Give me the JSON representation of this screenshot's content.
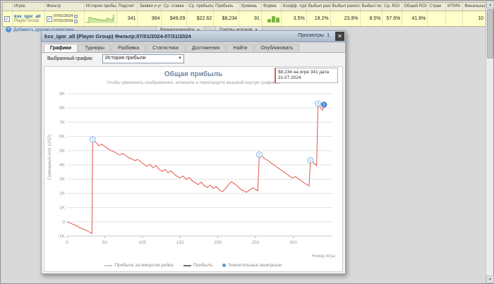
{
  "table": {
    "columns": [
      "",
      "Игрок",
      "Фильтр",
      "История прибыли",
      "Подсчет",
      "Заявки и уч.",
      "Ср. ставка",
      "Ср. прибыль",
      "Прибыль",
      "Уровень",
      "Форма",
      "Коэфф. турб.",
      "Выбыл рано",
      "Выбыл рано/средне",
      "Выбыл по.",
      "Ср. ROI",
      "Общий ROI",
      "Стран",
      "ИТМ%",
      "Финальные"
    ],
    "row": {
      "player_name": "ksv_igor_all",
      "player_type": "Player Group",
      "filter_date_from": "07/01/2024",
      "filter_date_to": "07/31/2024",
      "count": "341",
      "entries": "364",
      "avg_stake": "$49.09",
      "avg_profit": "$22.62",
      "profit": "$8,234",
      "ability": "91",
      "turbo_factor": "3.5%",
      "busted_early": "19.2%",
      "busted_early_mid": "23.9%",
      "busted_late": "8.5%",
      "avg_roi": "57.6%",
      "total_roi": "41.9%",
      "country": "",
      "itm": "",
      "final_tables": "10"
    }
  },
  "toolbar": {
    "add_stat_label": "Добавить другую статистику",
    "visualize_label": "Визуализируйте",
    "groups_label": "Группы игроков"
  },
  "window": {
    "title": "ksv_igor_all (Player Group) Фильтр:07/01/2024-07/31/2024",
    "views_label": "Просмотры",
    "views_count": "1",
    "tabs": [
      {
        "label": "Графики",
        "active": true
      },
      {
        "label": "Турниры",
        "active": false
      },
      {
        "label": "Разбивка",
        "active": false
      },
      {
        "label": "Статистика",
        "active": false
      },
      {
        "label": "Достижения",
        "active": false
      },
      {
        "label": "Найти",
        "active": false
      },
      {
        "label": "Опубликовать",
        "active": false
      }
    ],
    "selector_label": "Выбранный график:",
    "selector_value": "История прибыли"
  },
  "chart_data": {
    "type": "line",
    "title": "Общая прибыль",
    "subtitle": "Чтобы увеличить изображение, кликните и перетащите мышкой внутри графика.",
    "xlabel": "Номер игры",
    "ylabel": "Суммарный итог (USD)",
    "xlim": [
      0,
      352
    ],
    "ylim": [
      -1000,
      9000
    ],
    "xticks": [
      0,
      50,
      100,
      150,
      200,
      250,
      300
    ],
    "yticks": [
      {
        "v": 9000,
        "label": "9K"
      },
      {
        "v": 8000,
        "label": "8K"
      },
      {
        "v": 7000,
        "label": "7K"
      },
      {
        "v": 6000,
        "label": "6K"
      },
      {
        "v": 5000,
        "label": "5K"
      },
      {
        "v": 4000,
        "label": "4K"
      },
      {
        "v": 3000,
        "label": "3K"
      },
      {
        "v": 2000,
        "label": "2K"
      },
      {
        "v": 1000,
        "label": "1K"
      },
      {
        "v": 0,
        "label": "0"
      },
      {
        "v": -1000,
        "label": "-1K"
      }
    ],
    "line_color": "#e2574c",
    "marker_color": "#5b9bd5",
    "marker_highlight_color": "#3c78c8",
    "grid_color": "#e3e3e3",
    "points": [
      [
        0,
        0
      ],
      [
        4,
        -80
      ],
      [
        8,
        -180
      ],
      [
        12,
        -260
      ],
      [
        16,
        -380
      ],
      [
        20,
        -480
      ],
      [
        24,
        -560
      ],
      [
        27,
        -640
      ],
      [
        30,
        -730
      ],
      [
        33,
        -820
      ],
      [
        34,
        5780
      ],
      [
        38,
        5600
      ],
      [
        42,
        5350
      ],
      [
        46,
        5450
      ],
      [
        50,
        5300
      ],
      [
        54,
        5150
      ],
      [
        58,
        5000
      ],
      [
        62,
        4950
      ],
      [
        66,
        4800
      ],
      [
        70,
        4700
      ],
      [
        74,
        4800
      ],
      [
        78,
        4650
      ],
      [
        82,
        4500
      ],
      [
        86,
        4420
      ],
      [
        90,
        4300
      ],
      [
        94,
        4380
      ],
      [
        98,
        4200
      ],
      [
        102,
        4050
      ],
      [
        106,
        3900
      ],
      [
        110,
        4050
      ],
      [
        114,
        3800
      ],
      [
        118,
        3950
      ],
      [
        122,
        3700
      ],
      [
        126,
        3550
      ],
      [
        130,
        3680
      ],
      [
        134,
        3450
      ],
      [
        138,
        3580
      ],
      [
        142,
        3350
      ],
      [
        146,
        3200
      ],
      [
        150,
        3080
      ],
      [
        154,
        3220
      ],
      [
        158,
        2980
      ],
      [
        162,
        3120
      ],
      [
        166,
        2880
      ],
      [
        170,
        2750
      ],
      [
        174,
        2620
      ],
      [
        178,
        2780
      ],
      [
        182,
        2550
      ],
      [
        186,
        2420
      ],
      [
        190,
        2580
      ],
      [
        194,
        2350
      ],
      [
        198,
        2480
      ],
      [
        202,
        2250
      ],
      [
        206,
        2120
      ],
      [
        210,
        2320
      ],
      [
        214,
        2600
      ],
      [
        218,
        2820
      ],
      [
        222,
        2680
      ],
      [
        226,
        2520
      ],
      [
        230,
        2300
      ],
      [
        234,
        2180
      ],
      [
        238,
        2080
      ],
      [
        242,
        2230
      ],
      [
        246,
        2380
      ],
      [
        250,
        2280
      ],
      [
        253,
        2180
      ],
      [
        255,
        4720
      ],
      [
        259,
        4580
      ],
      [
        263,
        4420
      ],
      [
        267,
        4280
      ],
      [
        271,
        4120
      ],
      [
        275,
        3980
      ],
      [
        279,
        3820
      ],
      [
        283,
        3680
      ],
      [
        287,
        3520
      ],
      [
        291,
        3380
      ],
      [
        295,
        3220
      ],
      [
        299,
        3080
      ],
      [
        303,
        3180
      ],
      [
        307,
        3020
      ],
      [
        311,
        2880
      ],
      [
        315,
        2720
      ],
      [
        318,
        2620
      ],
      [
        321,
        2520
      ],
      [
        323,
        4320
      ],
      [
        326,
        4180
      ],
      [
        329,
        4050
      ],
      [
        331,
        3950
      ],
      [
        333,
        8300
      ],
      [
        335,
        8150
      ],
      [
        337,
        7950
      ],
      [
        339,
        7850
      ],
      [
        341,
        8234
      ]
    ],
    "markers": [
      {
        "x": 34,
        "y": 5780,
        "label": "1",
        "highlight": false
      },
      {
        "x": 255,
        "y": 4720,
        "label": "2",
        "highlight": false
      },
      {
        "x": 323,
        "y": 4320,
        "label": "3",
        "highlight": false
      },
      {
        "x": 333,
        "y": 8300,
        "label": "4",
        "highlight": false
      },
      {
        "x": 341,
        "y": 8234,
        "label": "5",
        "highlight": true
      }
    ],
    "tooltip": {
      "line1": "$8,234 на игре 341 дата",
      "line2": "31.07.2024"
    },
    "legend": [
      {
        "label": "Прибыль за минусом рейка",
        "type": "line",
        "color": "#c9c9c9"
      },
      {
        "label": "Прибыль",
        "type": "line",
        "color": "#6e6e6e"
      },
      {
        "label": "Значительные выигрыши",
        "type": "dot",
        "color": "#5b9bd5"
      }
    ]
  }
}
